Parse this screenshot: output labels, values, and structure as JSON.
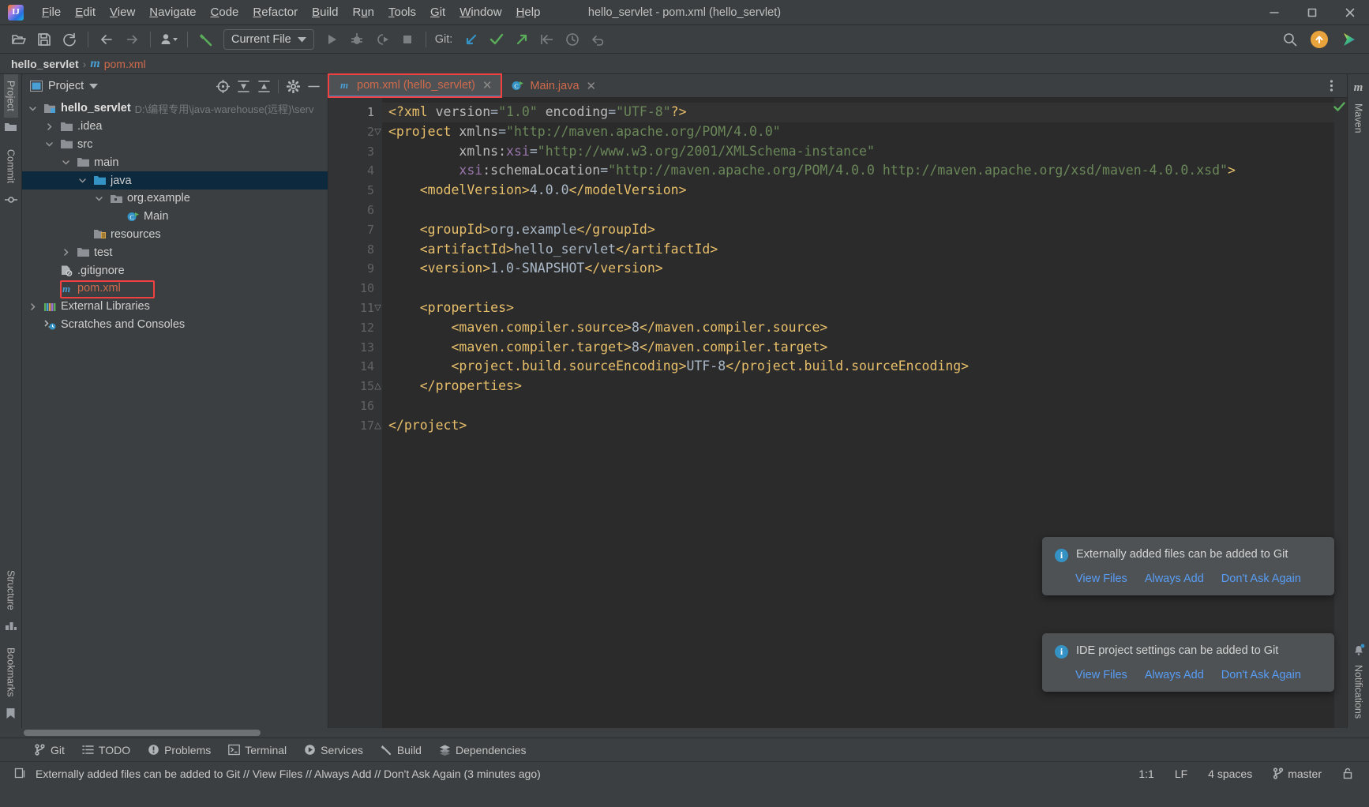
{
  "window": {
    "title": "hello_servlet - pom.xml (hello_servlet)",
    "logo_text": "IJ",
    "minimize": "−",
    "maximize": "□",
    "close": "✕"
  },
  "menubar": {
    "items": [
      {
        "label": "File",
        "mnemonic": "F"
      },
      {
        "label": "Edit",
        "mnemonic": "E"
      },
      {
        "label": "View",
        "mnemonic": "V"
      },
      {
        "label": "Navigate",
        "mnemonic": "N"
      },
      {
        "label": "Code",
        "mnemonic": "C"
      },
      {
        "label": "Refactor",
        "mnemonic": "R"
      },
      {
        "label": "Build",
        "mnemonic": "B"
      },
      {
        "label": "Run",
        "mnemonic": "u"
      },
      {
        "label": "Tools",
        "mnemonic": "T"
      },
      {
        "label": "Git",
        "mnemonic": "G"
      },
      {
        "label": "Window",
        "mnemonic": "W"
      },
      {
        "label": "Help",
        "mnemonic": "H"
      }
    ]
  },
  "toolbar": {
    "open_icon": "open-folder-icon",
    "save_icon": "save-icon",
    "sync_icon": "refresh-icon",
    "back_icon": "back-arrow-icon",
    "forward_icon": "forward-arrow-icon",
    "profile_icon": "user-dropdown-icon",
    "build_icon": "build-hammer-icon",
    "run_config_label": "Current File",
    "run_icon": "run-icon",
    "debug_icon": "debug-icon",
    "coverage_icon": "run-with-coverage-icon",
    "stop_icon": "stop-icon",
    "git_label": "Git:",
    "git_update_icon": "git-update-project-icon",
    "git_commit_icon": "git-commit-icon",
    "git_push_icon": "git-push-icon",
    "git_rollback_icon": "git-rollback-icon",
    "git_history_icon": "git-history-icon",
    "git_undo_icon": "git-undo-icon",
    "search_icon": "search-icon",
    "update_icon": "update-available-icon",
    "ide_icon": "ide-feature-icon"
  },
  "breadcrumb": {
    "project": "hello_servlet",
    "separator": "›",
    "file_icon": "m",
    "file": "pom.xml"
  },
  "left_rail": {
    "items": [
      {
        "label": "Project",
        "icon": "project-folder-icon",
        "active": true
      },
      {
        "label": "Commit",
        "icon": "commit-icon",
        "active": false
      },
      {
        "label": "Structure",
        "icon": "structure-icon",
        "active": false
      },
      {
        "label": "Bookmarks",
        "icon": "bookmark-icon",
        "active": false
      }
    ]
  },
  "right_rail": {
    "items": [
      {
        "label": "Maven",
        "icon": "maven-icon"
      },
      {
        "label": "Notifications",
        "icon": "notifications-bell-icon"
      }
    ]
  },
  "project_panel": {
    "title": "Project",
    "dropdown_icon": "chevron-down-icon",
    "header_icons": [
      {
        "name": "select-opened-file-icon"
      },
      {
        "name": "expand-all-icon"
      },
      {
        "name": "collapse-all-icon"
      },
      {
        "name": "settings-gear-icon"
      },
      {
        "name": "hide-panel-icon"
      }
    ],
    "tree": [
      {
        "indent": 0,
        "arrow": "v",
        "icon": "module-icon",
        "label": "hello_servlet",
        "bold": true,
        "path": "D:\\编程专用\\java-warehouse(远程)\\serv",
        "selected": false,
        "highlighted": false
      },
      {
        "indent": 1,
        "arrow": ">",
        "icon": "folder-icon",
        "label": ".idea",
        "bold": false,
        "path": "",
        "selected": false,
        "highlighted": false
      },
      {
        "indent": 1,
        "arrow": "v",
        "icon": "folder-icon",
        "label": "src",
        "bold": false,
        "path": "",
        "selected": false,
        "highlighted": false
      },
      {
        "indent": 2,
        "arrow": "v",
        "icon": "folder-icon",
        "label": "main",
        "bold": false,
        "path": "",
        "selected": false,
        "highlighted": false
      },
      {
        "indent": 3,
        "arrow": "v",
        "icon": "source-folder-icon",
        "label": "java",
        "bold": false,
        "path": "",
        "selected": true,
        "highlighted": false
      },
      {
        "indent": 4,
        "arrow": "v",
        "icon": "package-icon",
        "label": "org.example",
        "bold": false,
        "path": "",
        "selected": false,
        "highlighted": false
      },
      {
        "indent": 5,
        "arrow": "",
        "icon": "java-class-runnable-icon",
        "label": "Main",
        "bold": false,
        "path": "",
        "selected": false,
        "highlighted": false
      },
      {
        "indent": 3,
        "arrow": "",
        "icon": "resources-folder-icon",
        "label": "resources",
        "bold": false,
        "path": "",
        "selected": false,
        "highlighted": false
      },
      {
        "indent": 2,
        "arrow": ">",
        "icon": "folder-icon",
        "label": "test",
        "bold": false,
        "path": "",
        "selected": false,
        "highlighted": false
      },
      {
        "indent": 1,
        "arrow": "",
        "icon": "gitignore-icon",
        "label": ".gitignore",
        "bold": false,
        "path": "",
        "selected": false,
        "highlighted": false
      },
      {
        "indent": 1,
        "arrow": "",
        "icon": "maven-pom-icon",
        "label": "pom.xml",
        "bold": false,
        "path": "",
        "selected": false,
        "highlighted": true
      },
      {
        "indent": 0,
        "arrow": ">",
        "icon": "external-libraries-icon",
        "label": "External Libraries",
        "bold": false,
        "path": "",
        "selected": false,
        "highlighted": false
      },
      {
        "indent": 0,
        "arrow": "",
        "icon": "scratches-icon",
        "label": "Scratches and Consoles",
        "bold": false,
        "path": "",
        "selected": false,
        "highlighted": false
      }
    ]
  },
  "editor": {
    "tabs": [
      {
        "label": "pom.xml (hello_servlet)",
        "icon": "maven-pom-icon",
        "active": true,
        "highlighted": true,
        "close": "✕"
      },
      {
        "label": "Main.java",
        "icon": "java-class-runnable-icon",
        "active": false,
        "highlighted": false,
        "close": "✕"
      }
    ],
    "more_icon": "more-options-icon",
    "inspection_status_icon": "inspection-ok-checkmark",
    "line_numbers": [
      1,
      2,
      3,
      4,
      5,
      6,
      7,
      8,
      9,
      10,
      11,
      12,
      13,
      14,
      15,
      16,
      17
    ],
    "lines": [
      [
        {
          "t": "<?xml ",
          "c": "tag"
        },
        {
          "t": "version",
          "c": "attr"
        },
        {
          "t": "=",
          "c": "txt"
        },
        {
          "t": "\"1.0\"",
          "c": "str"
        },
        {
          "t": " ",
          "c": "txt"
        },
        {
          "t": "encoding",
          "c": "attr"
        },
        {
          "t": "=",
          "c": "txt"
        },
        {
          "t": "\"UTF-8\"",
          "c": "str"
        },
        {
          "t": "?>",
          "c": "tag"
        }
      ],
      [
        {
          "t": "<project ",
          "c": "tag"
        },
        {
          "t": "xmlns",
          "c": "attr"
        },
        {
          "t": "=",
          "c": "txt"
        },
        {
          "t": "\"http://maven.apache.org/POM/4.0.0\"",
          "c": "str"
        }
      ],
      [
        {
          "t": "         ",
          "c": "txt"
        },
        {
          "t": "xmlns:",
          "c": "attr"
        },
        {
          "t": "xsi",
          "c": "ns"
        },
        {
          "t": "=",
          "c": "txt"
        },
        {
          "t": "\"http://www.w3.org/2001/XMLSchema-instance\"",
          "c": "str"
        }
      ],
      [
        {
          "t": "         ",
          "c": "txt"
        },
        {
          "t": "xsi",
          "c": "ns"
        },
        {
          "t": ":schemaLocation",
          "c": "attr"
        },
        {
          "t": "=",
          "c": "txt"
        },
        {
          "t": "\"http://maven.apache.org/POM/4.0.0 http://maven.apache.org/xsd/maven-4.0.0.xsd\"",
          "c": "str"
        },
        {
          "t": ">",
          "c": "tag"
        }
      ],
      [
        {
          "t": "    ",
          "c": "txt"
        },
        {
          "t": "<modelVersion>",
          "c": "tag"
        },
        {
          "t": "4.0.0",
          "c": "val"
        },
        {
          "t": "</modelVersion>",
          "c": "tag"
        }
      ],
      [],
      [
        {
          "t": "    ",
          "c": "txt"
        },
        {
          "t": "<groupId>",
          "c": "tag"
        },
        {
          "t": "org.example",
          "c": "val"
        },
        {
          "t": "</groupId>",
          "c": "tag"
        }
      ],
      [
        {
          "t": "    ",
          "c": "txt"
        },
        {
          "t": "<artifactId>",
          "c": "tag"
        },
        {
          "t": "hello_servlet",
          "c": "val"
        },
        {
          "t": "</artifactId>",
          "c": "tag"
        }
      ],
      [
        {
          "t": "    ",
          "c": "txt"
        },
        {
          "t": "<version>",
          "c": "tag"
        },
        {
          "t": "1.0-SNAPSHOT",
          "c": "val"
        },
        {
          "t": "</version>",
          "c": "tag"
        }
      ],
      [],
      [
        {
          "t": "    ",
          "c": "txt"
        },
        {
          "t": "<properties>",
          "c": "tag"
        }
      ],
      [
        {
          "t": "        ",
          "c": "txt"
        },
        {
          "t": "<maven.compiler.source>",
          "c": "tag"
        },
        {
          "t": "8",
          "c": "val"
        },
        {
          "t": "</maven.compiler.source>",
          "c": "tag"
        }
      ],
      [
        {
          "t": "        ",
          "c": "txt"
        },
        {
          "t": "<maven.compiler.target>",
          "c": "tag"
        },
        {
          "t": "8",
          "c": "val"
        },
        {
          "t": "</maven.compiler.target>",
          "c": "tag"
        }
      ],
      [
        {
          "t": "        ",
          "c": "txt"
        },
        {
          "t": "<project.build.sourceEncoding>",
          "c": "tag"
        },
        {
          "t": "UTF-8",
          "c": "val"
        },
        {
          "t": "</project.build.sourceEncoding>",
          "c": "tag"
        }
      ],
      [
        {
          "t": "    ",
          "c": "txt"
        },
        {
          "t": "</properties>",
          "c": "tag"
        }
      ],
      [],
      [
        {
          "t": "</project>",
          "c": "tag"
        }
      ]
    ],
    "fold_markers": [
      {
        "line": 2,
        "glyph": "▽"
      },
      {
        "line": 11,
        "glyph": "▽"
      },
      {
        "line": 15,
        "glyph": "△"
      },
      {
        "line": 17,
        "glyph": "△"
      }
    ]
  },
  "notifications": [
    {
      "icon": "info-icon",
      "message": "Externally added files can be added to Git",
      "actions": [
        "View Files",
        "Always Add",
        "Don't Ask Again"
      ]
    },
    {
      "icon": "info-icon",
      "message": "IDE project settings can be added to Git",
      "actions": [
        "View Files",
        "Always Add",
        "Don't Ask Again"
      ]
    }
  ],
  "tool_windows": [
    {
      "label": "Git",
      "icon": "git-branch-icon"
    },
    {
      "label": "TODO",
      "icon": "todo-list-icon"
    },
    {
      "label": "Problems",
      "icon": "problems-icon"
    },
    {
      "label": "Terminal",
      "icon": "terminal-icon"
    },
    {
      "label": "Services",
      "icon": "services-icon"
    },
    {
      "label": "Build",
      "icon": "build-hammer-icon"
    },
    {
      "label": "Dependencies",
      "icon": "dependencies-icon"
    }
  ],
  "statusbar": {
    "icon": "event-log-icon",
    "message": "Externally added files can be added to Git // View Files // Always Add // Don't Ask Again (3 minutes ago)",
    "caret_position": "1:1",
    "line_separator": "LF",
    "indent": "4 spaces",
    "branch_icon": "git-branch-icon",
    "branch": "master",
    "lock_icon": "unlocked-icon"
  },
  "colors": {
    "accent_blue": "#4a88c7",
    "link_blue": "#589df6",
    "highlight_red": "#f04040",
    "tag_orange": "#e8bf6a",
    "string_green": "#6a8759",
    "selection_blue": "#0d293e"
  }
}
